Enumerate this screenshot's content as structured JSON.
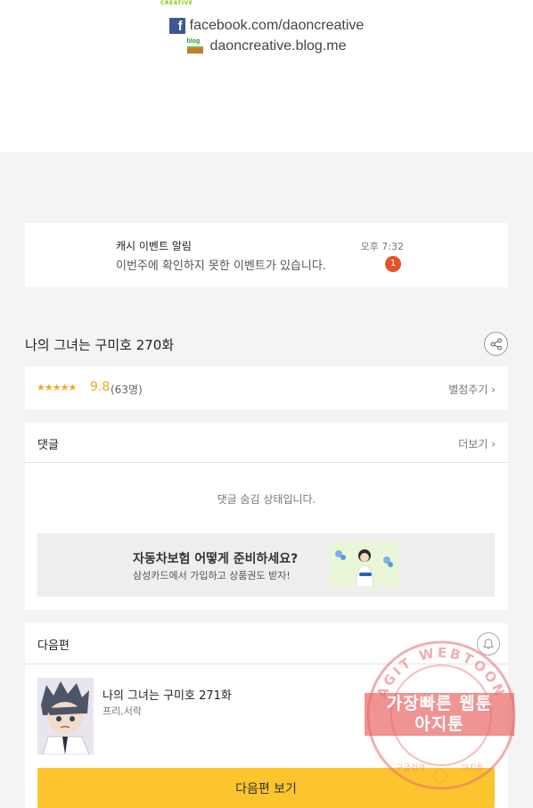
{
  "credits": {
    "logo_text": "CREATIVE",
    "facebook": "facebook.com/daoncreative",
    "blog_badge": "blog",
    "blog": "daoncreative.blog.me"
  },
  "notification": {
    "title": "캐시 이벤트 알림",
    "body": "이번주에 확인하지 못한 이벤트가 있습니다.",
    "time": "오후 7:32",
    "badge_count": "1"
  },
  "episode": {
    "title": "나의 그녀는 구미호 270화",
    "stars": "★★★★★",
    "score": "9.8",
    "rating_count": "(63명)",
    "rate_link": "별점주기 ›"
  },
  "comments": {
    "title": "댓글",
    "more": "더보기 ›",
    "hidden_message": "댓글 숨김 상태입니다."
  },
  "ad": {
    "title": "자동차보험 어떻게 준비하세요?",
    "subtitle": "삼성카드에서 가입하고 상품권도 받자!"
  },
  "next": {
    "section_title": "다음편",
    "episode_title": "나의 그녀는 구미호 271화",
    "genre": "프리,서락",
    "view_button": "다음편 보기"
  },
  "watermark": {
    "ring_text": "AGIT WEBTOON",
    "label": "가장빠른 웹툰\n아지툰",
    "bottom_left": "구글검색",
    "bottom_right": "아지툰"
  },
  "colors": {
    "accent_yellow": "#fdc52d",
    "star_orange": "#f5a623",
    "badge_red": "#e8522b",
    "facebook_blue": "#3b5998",
    "stamp_red": "#e96a6a"
  }
}
